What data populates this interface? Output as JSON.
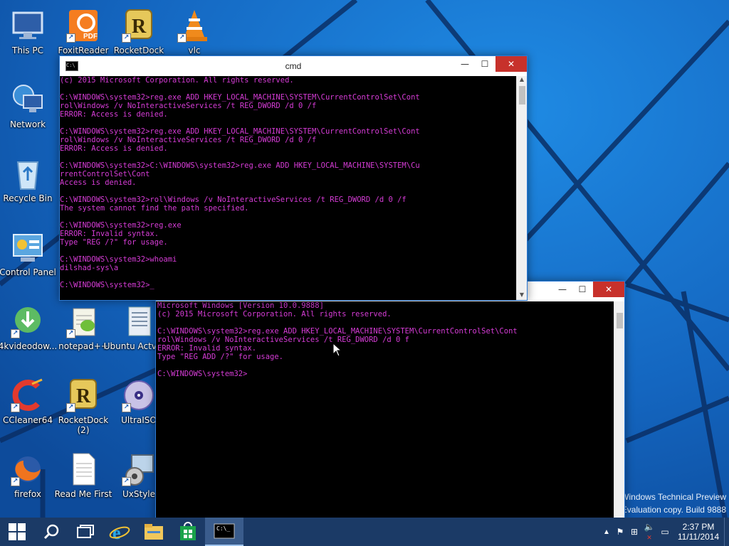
{
  "desktop": {
    "icons": [
      {
        "label": "This PC",
        "icon": "computer-icon"
      },
      {
        "label": "FoxitReader",
        "icon": "foxit-pdf-icon"
      },
      {
        "label": "RocketDock",
        "icon": "rocketdock-icon"
      },
      {
        "label": "vlc",
        "icon": "vlc-cone-icon"
      },
      {
        "label": "Network",
        "icon": "network-icon"
      },
      {
        "label": "Recycle Bin",
        "icon": "recycle-bin-icon"
      },
      {
        "label": "Control Panel",
        "icon": "control-panel-icon"
      },
      {
        "label": "4kvideodow...",
        "icon": "4k-downloader-icon"
      },
      {
        "label": "notepad++",
        "icon": "notepadpp-icon"
      },
      {
        "label": "Ubuntu Actvator",
        "icon": "ubuntu-activator-icon"
      },
      {
        "label": "CCleaner64",
        "icon": "ccleaner-icon"
      },
      {
        "label": "RocketDock (2)",
        "icon": "rocketdock-icon"
      },
      {
        "label": "UltraISO",
        "icon": "ultraiso-disc-icon"
      },
      {
        "label": "firefox",
        "icon": "firefox-icon"
      },
      {
        "label": "Read Me First",
        "icon": "text-document-icon"
      },
      {
        "label": "UxStyle",
        "icon": "uxstyle-icon"
      }
    ]
  },
  "cmd_window_1": {
    "title": "cmd",
    "minimize": "—",
    "maximize": "☐",
    "close": "✕",
    "text": "(c) 2015 Microsoft Corporation. All rights reserved.\n\nC:\\WINDOWS\\system32>reg.exe ADD HKEY_LOCAL_MACHINE\\SYSTEM\\CurrentControlSet\\Cont\nrol\\Windows /v NoInteractiveServices /t REG_DWORD /d 0 /f\nERROR: Access is denied.\n\nC:\\WINDOWS\\system32>reg.exe ADD HKEY_LOCAL_MACHINE\\SYSTEM\\CurrentControlSet\\Cont\nrol\\Windows /v NoInteractiveServices /t REG_DWORD /d 0 /f\nERROR: Access is denied.\n\nC:\\WINDOWS\\system32>C:\\WINDOWS\\system32>reg.exe ADD HKEY_LOCAL_MACHINE\\SYSTEM\\Cu\nrrentControlSet\\Cont\nAccess is denied.\n\nC:\\WINDOWS\\system32>rol\\Windows /v NoInteractiveServices /t REG_DWORD /d 0 /f\nThe system cannot find the path specified.\n\nC:\\WINDOWS\\system32>reg.exe\nERROR: Invalid syntax.\nType \"REG /?\" for usage.\n\nC:\\WINDOWS\\system32>whoami\ndilshad-sys\\a\n\nC:\\WINDOWS\\system32>_"
  },
  "cmd_window_2": {
    "minimize": "—",
    "maximize": "☐",
    "close": "✕",
    "text": "Microsoft Windows [Version 10.0.9888]\n(c) 2015 Microsoft Corporation. All rights reserved.\n\nC:\\WINDOWS\\system32>reg.exe ADD HKEY_LOCAL_MACHINE\\SYSTEM\\CurrentControlSet\\Cont\nrol\\Windows /v NoInteractiveServices /t REG_DWORD /d 0 f\nERROR: Invalid syntax.\nType \"REG ADD /?\" for usage.\n\nC:\\WINDOWS\\system32>"
  },
  "watermark": {
    "line1": "Windows Technical Preview",
    "line2": "Evaluation copy. Build 9888"
  },
  "taskbar": {
    "items": [
      "windows-start-icon",
      "search-icon",
      "task-view-icon",
      "internet-explorer-icon",
      "file-explorer-icon",
      "store-icon",
      "cmd-icon"
    ],
    "clock_time": "2:37 PM",
    "clock_date": "11/11/2014"
  },
  "colors": {
    "console_text": "#d63cd6",
    "console_bg": "#000000",
    "taskbar": "#1b3a66",
    "close_button": "#c7312b"
  }
}
